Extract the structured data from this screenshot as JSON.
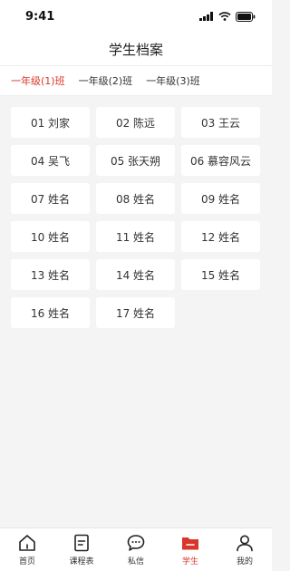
{
  "status_bar": {
    "time": "9:41"
  },
  "nav": {
    "title": "学生档案"
  },
  "class_tabs": [
    {
      "label": "一年级(1)班",
      "active": true
    },
    {
      "label": "一年级(2)班",
      "active": false
    },
    {
      "label": "一年级(3)班",
      "active": false
    }
  ],
  "students": [
    {
      "label": "01 刘家"
    },
    {
      "label": "02 陈远"
    },
    {
      "label": "03 王云"
    },
    {
      "label": "04 吴飞"
    },
    {
      "label": "05 张天朔"
    },
    {
      "label": "06 慕容风云"
    },
    {
      "label": "07 姓名"
    },
    {
      "label": "08 姓名"
    },
    {
      "label": "09 姓名"
    },
    {
      "label": "10 姓名"
    },
    {
      "label": "11 姓名"
    },
    {
      "label": "12 姓名"
    },
    {
      "label": "13 姓名"
    },
    {
      "label": "14 姓名"
    },
    {
      "label": "15 姓名"
    },
    {
      "label": "16 姓名"
    },
    {
      "label": "17 姓名"
    }
  ],
  "tab_bar": [
    {
      "label": "首页",
      "icon": "home-icon",
      "active": false
    },
    {
      "label": "课程表",
      "icon": "schedule-icon",
      "active": false
    },
    {
      "label": "私信",
      "icon": "message-icon",
      "active": false
    },
    {
      "label": "学生",
      "icon": "folder-icon",
      "active": true
    },
    {
      "label": "我的",
      "icon": "user-icon",
      "active": false
    }
  ],
  "colors": {
    "accent": "#d9362b",
    "background": "#f4f4f4",
    "card": "#ffffff"
  }
}
